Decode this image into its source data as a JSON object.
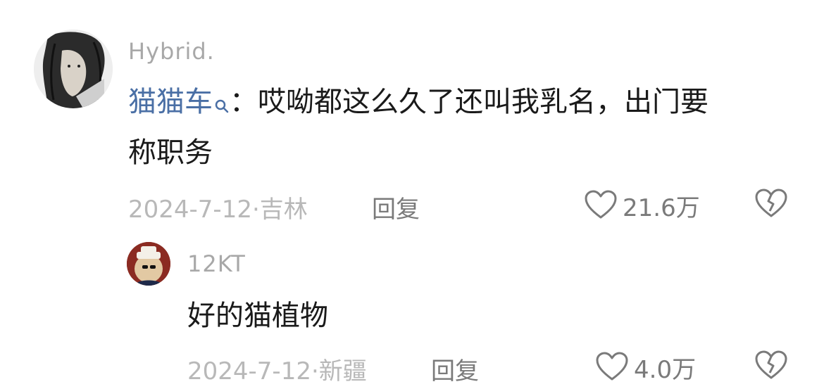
{
  "comments": [
    {
      "username": "Hybrid.",
      "mention": "猫猫车",
      "separator": "：",
      "text_line1": "哎呦都这么久了还叫我乳名，出门要",
      "text_line2": "称职务",
      "date": "2024-7-12·",
      "location": "吉林",
      "reply_label": "回复",
      "likes": "21.6万",
      "avatar": "hybrid-avatar"
    },
    {
      "username": "12KT",
      "text": "好的猫植物",
      "date": "2024-7-12·",
      "location": "新疆",
      "reply_label": "回复",
      "likes": "4.0万",
      "avatar": "12kt-avatar"
    }
  ],
  "icons": {
    "like": "heart-outline-icon",
    "dislike": "broken-heart-icon",
    "mention": "search-icon"
  },
  "colors": {
    "mention": "#4a6fa5",
    "username": "#a8a8a8",
    "meta": "#b8b8b8",
    "action": "#7a7a7a",
    "text": "#1a1a1a"
  }
}
